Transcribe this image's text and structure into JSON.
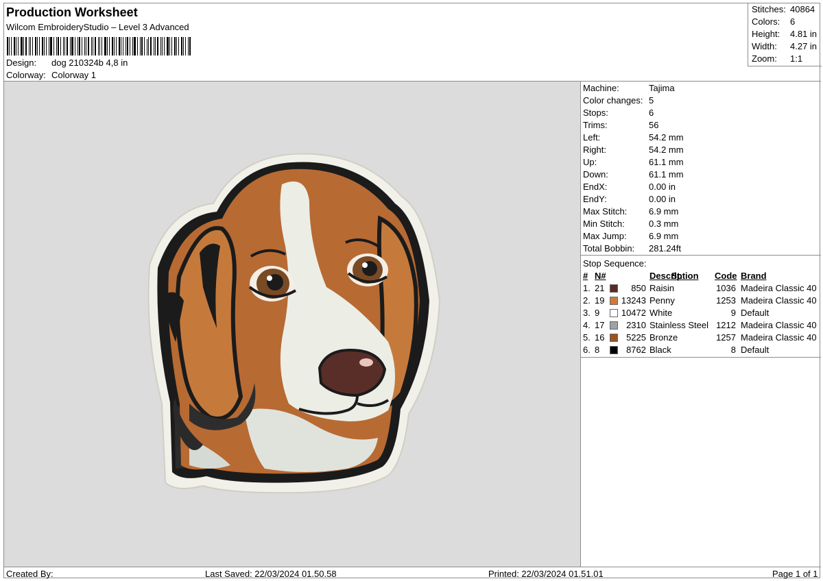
{
  "header": {
    "title": "Production Worksheet",
    "subtitle": "Wilcom EmbroideryStudio – Level 3 Advanced",
    "design_label": "Design:",
    "design_value": "dog 210324b 4,8 in",
    "colorway_label": "Colorway:",
    "colorway_value": "Colorway 1"
  },
  "stats": [
    {
      "label": "Stitches:",
      "value": "40864"
    },
    {
      "label": "Colors:",
      "value": "6"
    },
    {
      "label": "Height:",
      "value": "4.81 in"
    },
    {
      "label": "Width:",
      "value": "4.27 in"
    },
    {
      "label": "Zoom:",
      "value": "1:1"
    }
  ],
  "machine_info": [
    {
      "label": "Machine:",
      "value": "Tajima"
    },
    {
      "label": "Color changes:",
      "value": "5"
    },
    {
      "label": "Stops:",
      "value": "6"
    },
    {
      "label": "Trims:",
      "value": "56"
    },
    {
      "label": "Left:",
      "value": "54.2 mm"
    },
    {
      "label": "Right:",
      "value": "54.2 mm"
    },
    {
      "label": "Up:",
      "value": "61.1 mm"
    },
    {
      "label": "Down:",
      "value": "61.1 mm"
    },
    {
      "label": "EndX:",
      "value": "0.00 in"
    },
    {
      "label": "EndY:",
      "value": "0.00 in"
    },
    {
      "label": "Max Stitch:",
      "value": "6.9 mm"
    },
    {
      "label": "Min Stitch:",
      "value": "0.3 mm"
    },
    {
      "label": "Max Jump:",
      "value": "6.9 mm"
    },
    {
      "label": "Total Bobbin:",
      "value": "281.24ft"
    }
  ],
  "stop_sequence": {
    "title": "Stop Sequence:",
    "headers": {
      "num": "#",
      "n": "N#",
      "st": "St.",
      "description": "Description",
      "code": "Code",
      "brand": "Brand"
    },
    "rows": [
      {
        "num": "1.",
        "n": "21",
        "st": "850",
        "description": "Raisin",
        "code": "1036",
        "brand": "Madeira Classic 40",
        "color": "#5a2a24"
      },
      {
        "num": "2.",
        "n": "19",
        "st": "13243",
        "description": "Penny",
        "code": "1253",
        "brand": "Madeira Classic 40",
        "color": "#d07a3c"
      },
      {
        "num": "3.",
        "n": "9",
        "st": "10472",
        "description": "White",
        "code": "9",
        "brand": "Default",
        "color": "#ffffff"
      },
      {
        "num": "4.",
        "n": "17",
        "st": "2310",
        "description": "Stainless Steel",
        "code": "1212",
        "brand": "Madeira Classic 40",
        "color": "#9ea4a6"
      },
      {
        "num": "5.",
        "n": "16",
        "st": "5225",
        "description": "Bronze",
        "code": "1257",
        "brand": "Madeira Classic 40",
        "color": "#9a5421"
      },
      {
        "num": "6.",
        "n": "8",
        "st": "8762",
        "description": "Black",
        "code": "8",
        "brand": "Default",
        "color": "#000000"
      }
    ]
  },
  "footer": {
    "created_by": "Created By:",
    "last_saved": "Last Saved: 22/03/2024 01.50.58",
    "printed": "Printed: 22/03/2024 01.51.01",
    "page": "Page 1 of 1"
  },
  "preview": {
    "image_description": "beagle-head-embroidery"
  }
}
